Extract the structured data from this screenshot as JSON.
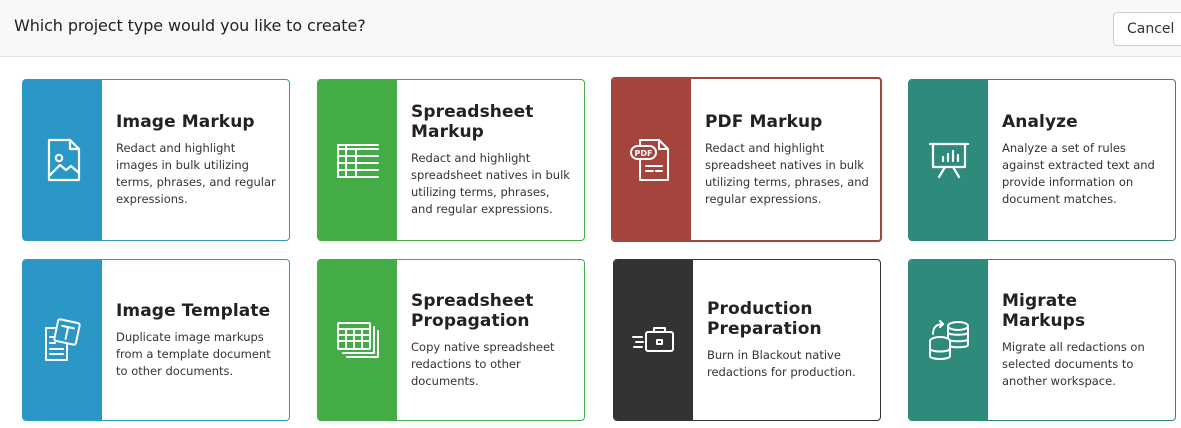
{
  "header": {
    "title": "Which project type would you like to create?",
    "cancel_label": "Cancel"
  },
  "cards": [
    {
      "title": "Image Markup",
      "desc": "Redact and highlight images in bulk utilizing terms, phrases, and regular expressions.",
      "color": "#2a97c6",
      "icon": "image-file-icon"
    },
    {
      "title": "Spreadsheet Markup",
      "desc": "Redact and highlight spreadsheet natives in bulk utilizing terms, phrases, and regular expressions.",
      "color": "#43ac47",
      "icon": "spreadsheet-icon"
    },
    {
      "title": "PDF Markup",
      "desc": "Redact and highlight spreadsheet natives in bulk utilizing terms, phrases, and regular expressions.",
      "color": "#a3453c",
      "icon": "pdf-file-icon",
      "selected": true
    },
    {
      "title": "Analyze",
      "desc": "Analyze a set of rules against extracted text and provide information on document matches.",
      "color": "#2e8a7b",
      "icon": "presentation-chart-icon"
    },
    {
      "title": "Image Template",
      "desc": "Duplicate image markups from a template document to other documents.",
      "color": "#2a97c6",
      "icon": "template-document-icon"
    },
    {
      "title": "Spreadsheet Propagation",
      "desc": "Copy native spreadsheet redactions to other documents.",
      "color": "#43ac47",
      "icon": "stacked-spreadsheets-icon"
    },
    {
      "title": "Production Preparation",
      "desc": "Burn in Blackout native redactions for production.",
      "color": "#333333",
      "icon": "moving-briefcase-icon"
    },
    {
      "title": "Migrate Markups",
      "desc": "Migrate all redactions on selected documents to another workspace.",
      "color": "#2e8a7b",
      "icon": "migrate-database-icon"
    }
  ]
}
